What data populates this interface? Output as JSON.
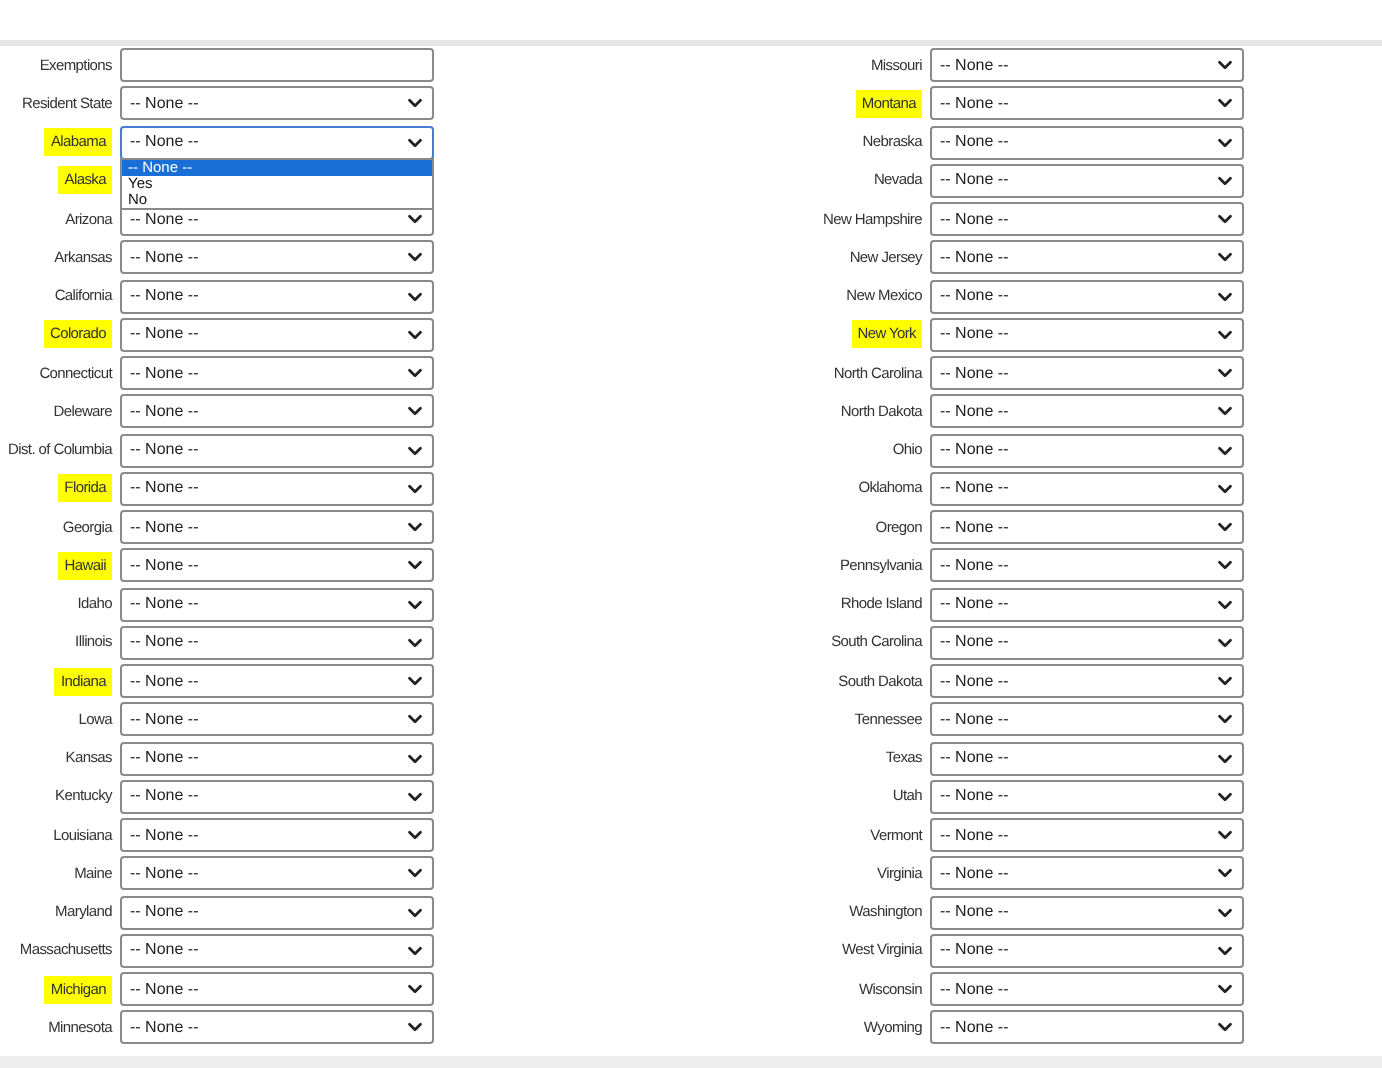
{
  "left_column": [
    {
      "label": "Exemptions",
      "kind": "text",
      "highlighted": false
    },
    {
      "label": "Resident State",
      "kind": "select",
      "value": "-- None --",
      "highlighted": false
    },
    {
      "label": "Alabama",
      "kind": "select",
      "value": "-- None --",
      "highlighted": true,
      "open_dropdown": {
        "options": [
          {
            "label": "-- None --",
            "selected": true
          },
          {
            "label": "Yes",
            "selected": false
          },
          {
            "label": "No",
            "selected": false
          }
        ]
      }
    },
    {
      "label": "Alaska",
      "kind": "select",
      "highlighted": true
    },
    {
      "label": "Arizona",
      "kind": "select",
      "value": "-- None --",
      "highlighted": false
    },
    {
      "label": "Arkansas",
      "kind": "select",
      "value": "-- None --",
      "highlighted": false
    },
    {
      "label": "California",
      "kind": "select",
      "value": "-- None --",
      "highlighted": false
    },
    {
      "label": "Colorado",
      "kind": "select",
      "value": "-- None --",
      "highlighted": true
    },
    {
      "label": "Connecticut",
      "kind": "select",
      "value": "-- None --",
      "highlighted": false
    },
    {
      "label": "Deleware",
      "kind": "select",
      "value": "-- None --",
      "highlighted": false
    },
    {
      "label": "Dist. of Columbia",
      "kind": "select",
      "value": "-- None --",
      "highlighted": false
    },
    {
      "label": "Florida",
      "kind": "select",
      "value": "-- None --",
      "highlighted": true
    },
    {
      "label": "Georgia",
      "kind": "select",
      "value": "-- None --",
      "highlighted": false
    },
    {
      "label": "Hawaii",
      "kind": "select",
      "value": "-- None --",
      "highlighted": true
    },
    {
      "label": "Idaho",
      "kind": "select",
      "value": "-- None --",
      "highlighted": false
    },
    {
      "label": "Illinois",
      "kind": "select",
      "value": "-- None --",
      "highlighted": false
    },
    {
      "label": "Indiana",
      "kind": "select",
      "value": "-- None --",
      "highlighted": true
    },
    {
      "label": "Lowa",
      "kind": "select",
      "value": "-- None --",
      "highlighted": false
    },
    {
      "label": "Kansas",
      "kind": "select",
      "value": "-- None --",
      "highlighted": false
    },
    {
      "label": "Kentucky",
      "kind": "select",
      "value": "-- None --",
      "highlighted": false
    },
    {
      "label": "Louisiana",
      "kind": "select",
      "value": "-- None --",
      "highlighted": false
    },
    {
      "label": "Maine",
      "kind": "select",
      "value": "-- None --",
      "highlighted": false
    },
    {
      "label": "Maryland",
      "kind": "select",
      "value": "-- None --",
      "highlighted": false
    },
    {
      "label": "Massachusetts",
      "kind": "select",
      "value": "-- None --",
      "highlighted": false
    },
    {
      "label": "Michigan",
      "kind": "select",
      "value": "-- None --",
      "highlighted": true
    },
    {
      "label": "Minnesota",
      "kind": "select",
      "value": "-- None --",
      "highlighted": false
    }
  ],
  "right_column": [
    {
      "label": "Missouri",
      "kind": "select",
      "value": "-- None --",
      "highlighted": false
    },
    {
      "label": "Montana",
      "kind": "select",
      "value": "-- None --",
      "highlighted": true
    },
    {
      "label": "Nebraska",
      "kind": "select",
      "value": "-- None --",
      "highlighted": false
    },
    {
      "label": "Nevada",
      "kind": "select",
      "value": "-- None --",
      "highlighted": false
    },
    {
      "label": "New Hampshire",
      "kind": "select",
      "value": "-- None --",
      "highlighted": false
    },
    {
      "label": "New Jersey",
      "kind": "select",
      "value": "-- None --",
      "highlighted": false
    },
    {
      "label": "New Mexico",
      "kind": "select",
      "value": "-- None --",
      "highlighted": false
    },
    {
      "label": "New York",
      "kind": "select",
      "value": "-- None --",
      "highlighted": true
    },
    {
      "label": "North Carolina",
      "kind": "select",
      "value": "-- None --",
      "highlighted": false
    },
    {
      "label": "North Dakota",
      "kind": "select",
      "value": "-- None --",
      "highlighted": false
    },
    {
      "label": "Ohio",
      "kind": "select",
      "value": "-- None --",
      "highlighted": false
    },
    {
      "label": "Oklahoma",
      "kind": "select",
      "value": "-- None --",
      "highlighted": false
    },
    {
      "label": "Oregon",
      "kind": "select",
      "value": "-- None --",
      "highlighted": false
    },
    {
      "label": "Pennsylvania",
      "kind": "select",
      "value": "-- None --",
      "highlighted": false
    },
    {
      "label": "Rhode Island",
      "kind": "select",
      "value": "-- None --",
      "highlighted": false
    },
    {
      "label": "South Carolina",
      "kind": "select",
      "value": "-- None --",
      "highlighted": false
    },
    {
      "label": "South Dakota",
      "kind": "select",
      "value": "-- None --",
      "highlighted": false
    },
    {
      "label": "Tennessee",
      "kind": "select",
      "value": "-- None --",
      "highlighted": false
    },
    {
      "label": "Texas",
      "kind": "select",
      "value": "-- None --",
      "highlighted": false
    },
    {
      "label": "Utah",
      "kind": "select",
      "value": "-- None --",
      "highlighted": false
    },
    {
      "label": "Vermont",
      "kind": "select",
      "value": "-- None --",
      "highlighted": false
    },
    {
      "label": "Virginia",
      "kind": "select",
      "value": "-- None --",
      "highlighted": false
    },
    {
      "label": "Washington",
      "kind": "select",
      "value": "-- None --",
      "highlighted": false
    },
    {
      "label": "West Virginia",
      "kind": "select",
      "value": "-- None --",
      "highlighted": false
    },
    {
      "label": "Wisconsin",
      "kind": "select",
      "value": "-- None --",
      "highlighted": false
    },
    {
      "label": "Wyoming",
      "kind": "select",
      "value": "-- None --",
      "highlighted": false
    }
  ]
}
